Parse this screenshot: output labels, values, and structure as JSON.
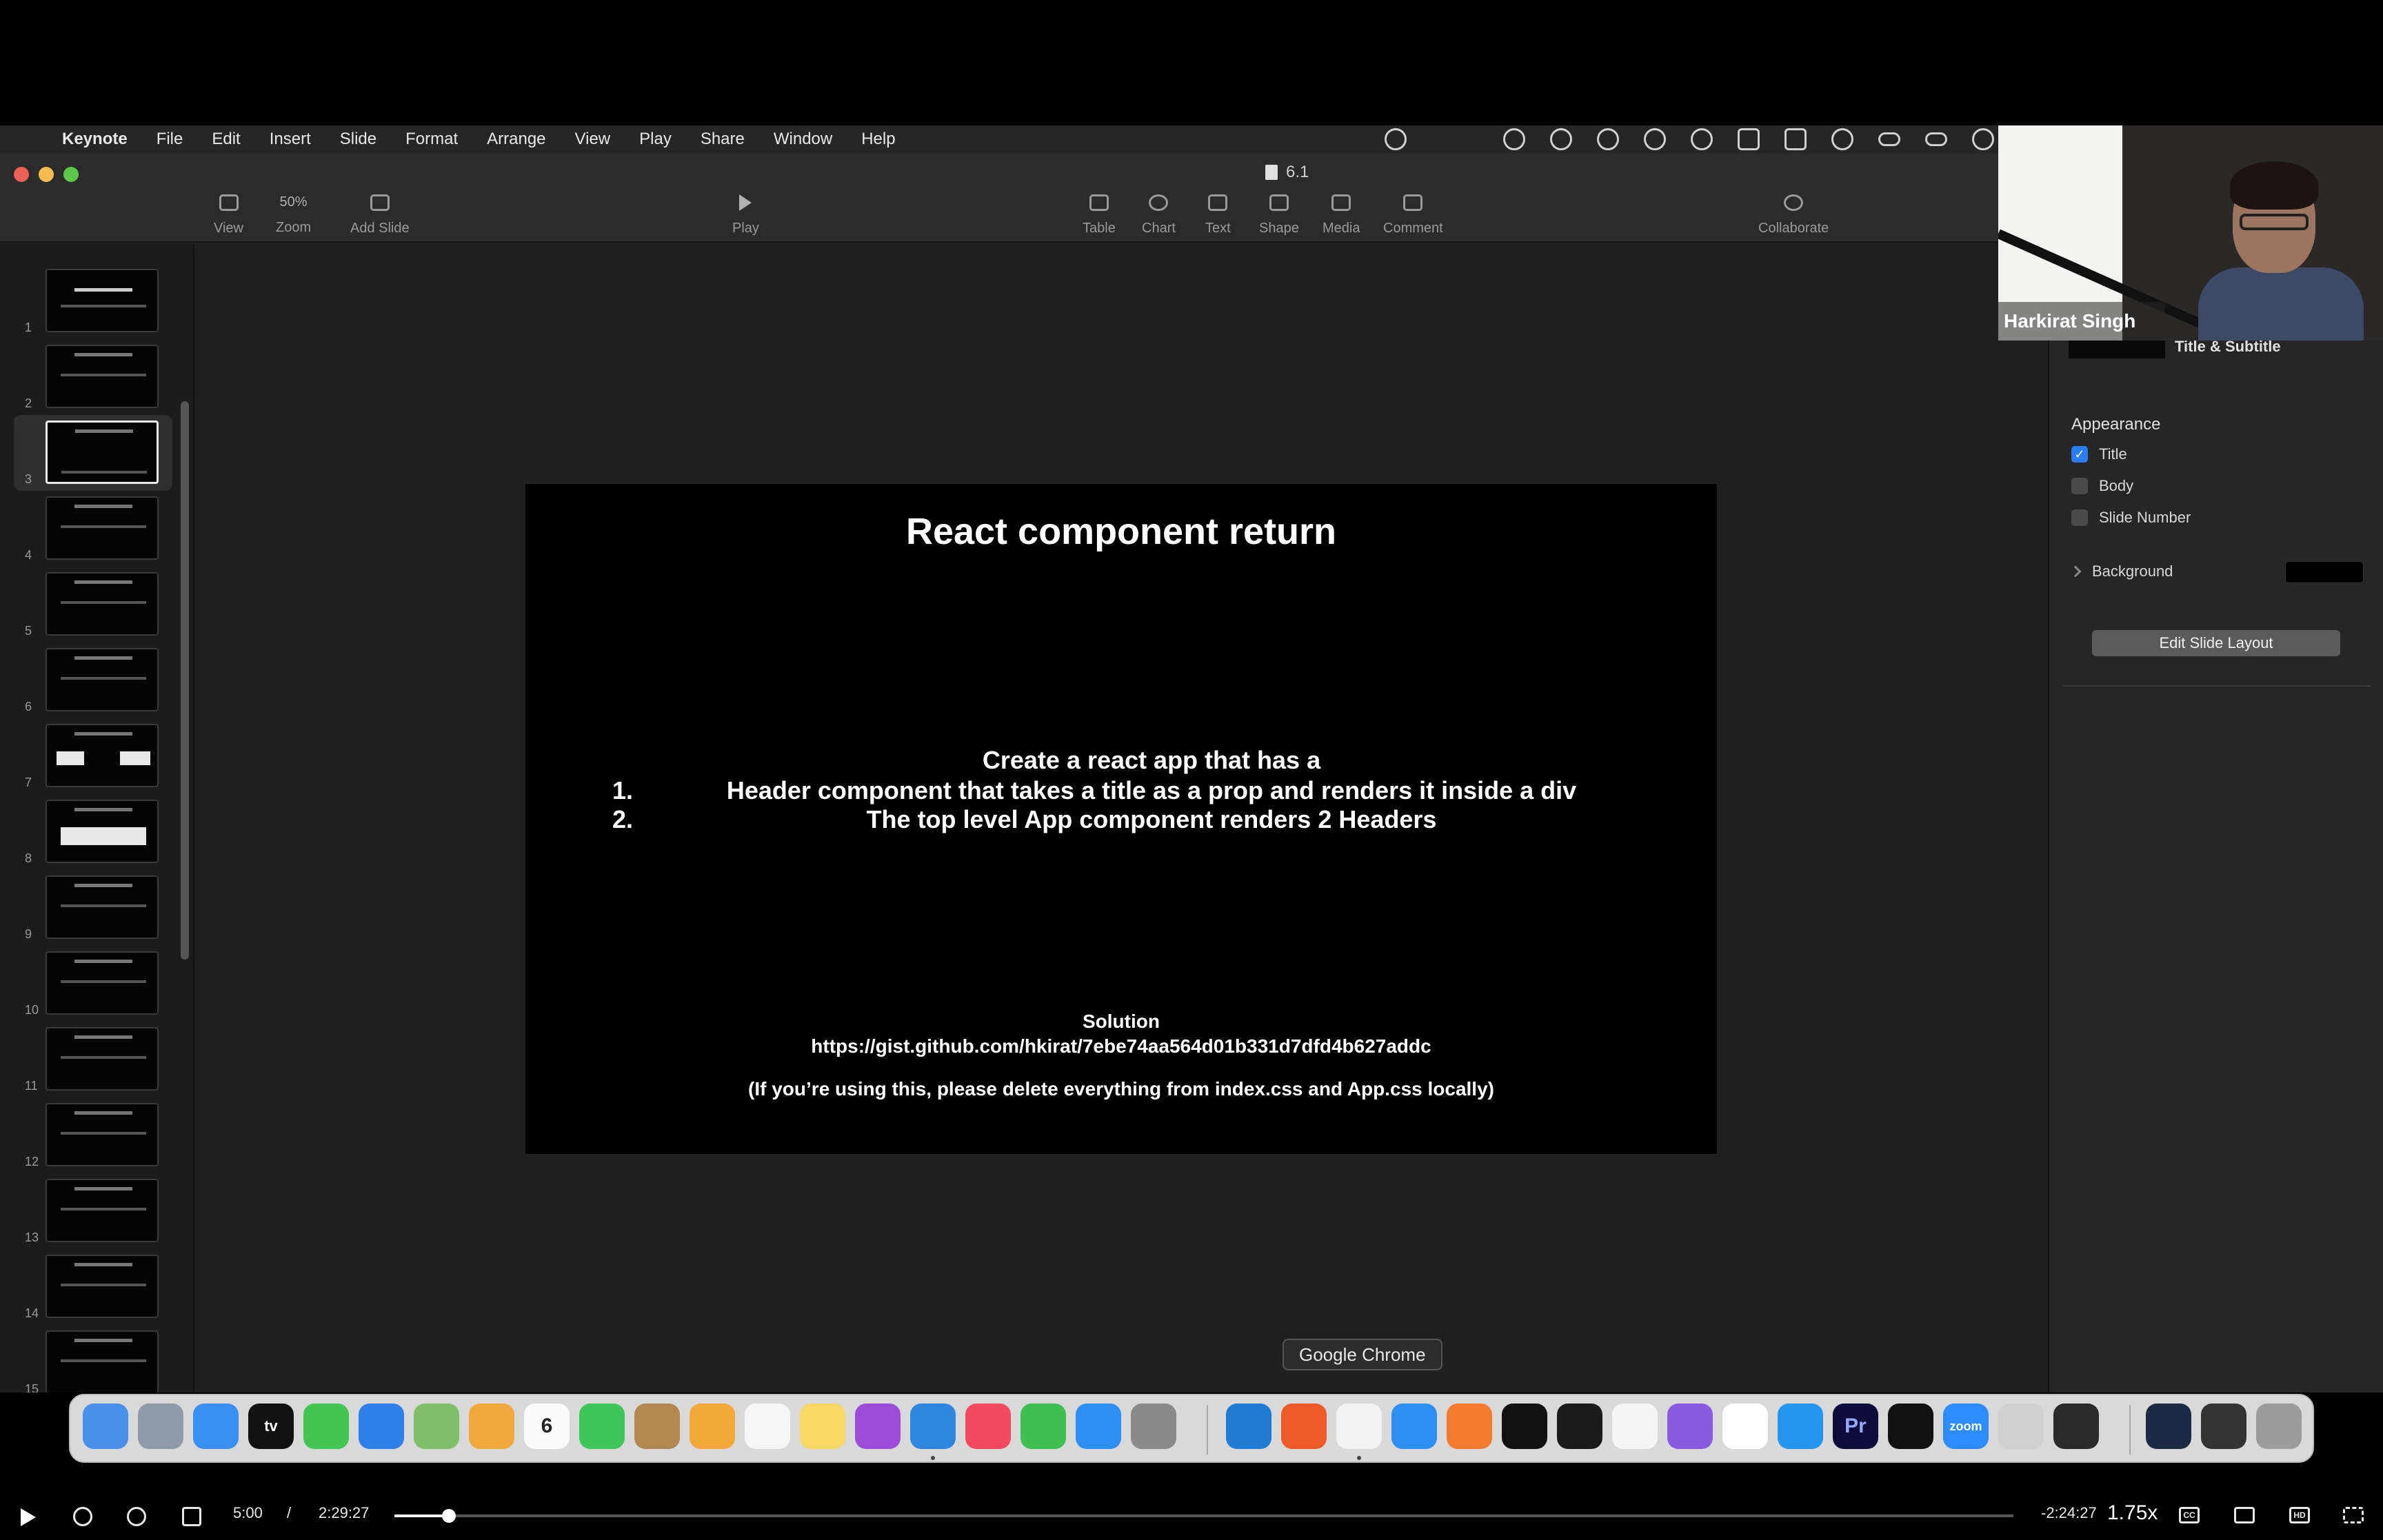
{
  "menubar": {
    "app_name": "Keynote",
    "items": [
      "File",
      "Edit",
      "Insert",
      "Slide",
      "Format",
      "Arrange",
      "View",
      "Play",
      "Share",
      "Window",
      "Help"
    ]
  },
  "window": {
    "document_title": "6.1",
    "toolbar": {
      "view": "View",
      "zoom_value": "50%",
      "zoom": "Zoom",
      "add_slide": "Add Slide",
      "play": "Play",
      "table": "Table",
      "chart": "Chart",
      "text": "Text",
      "shape": "Shape",
      "media": "Media",
      "comment": "Comment",
      "collaborate": "Collaborate"
    }
  },
  "navigator": {
    "selected_slide": 3,
    "slide_numbers": [
      "1",
      "2",
      "3",
      "4",
      "5",
      "6",
      "7",
      "8",
      "9",
      "10",
      "11",
      "12",
      "13",
      "14",
      "15"
    ]
  },
  "slide": {
    "title": "React component return",
    "intro": "Create a react app that has a",
    "items": [
      {
        "num": "1.",
        "text": "Header component that takes a title as a prop and renders it inside a div"
      },
      {
        "num": "2.",
        "text": "The top level App component renders 2 Headers"
      }
    ],
    "solution_label": "Solution",
    "solution_link": "https://gist.github.com/hkirat/7ebe74aa564d01b331d7dfd4b627addc",
    "solution_note": "(If you’re using this, please delete everything from index.css and App.css locally)"
  },
  "inspector": {
    "layout_name": "Title & Subtitle",
    "appearance_title": "Appearance",
    "checkboxes": [
      {
        "label": "Title",
        "checked": true
      },
      {
        "label": "Body",
        "checked": false
      },
      {
        "label": "Slide Number",
        "checked": false
      }
    ],
    "background_label": "Background",
    "edit_layout_button": "Edit Slide Layout"
  },
  "webcam": {
    "name": "Harkirat Singh"
  },
  "dock": {
    "tooltip": "Google Chrome",
    "calendar_day": "6",
    "tv_label": "tv",
    "premiere_label": "Pr",
    "zoom_label": "zoom"
  },
  "player": {
    "current_time": "5:00",
    "separator": "/",
    "duration": "2:29:27",
    "remaining": "-2:24:27",
    "speed": "1.75x",
    "cc_label": "CC",
    "hd_label": "HD",
    "progress_fraction": 0.0335
  }
}
